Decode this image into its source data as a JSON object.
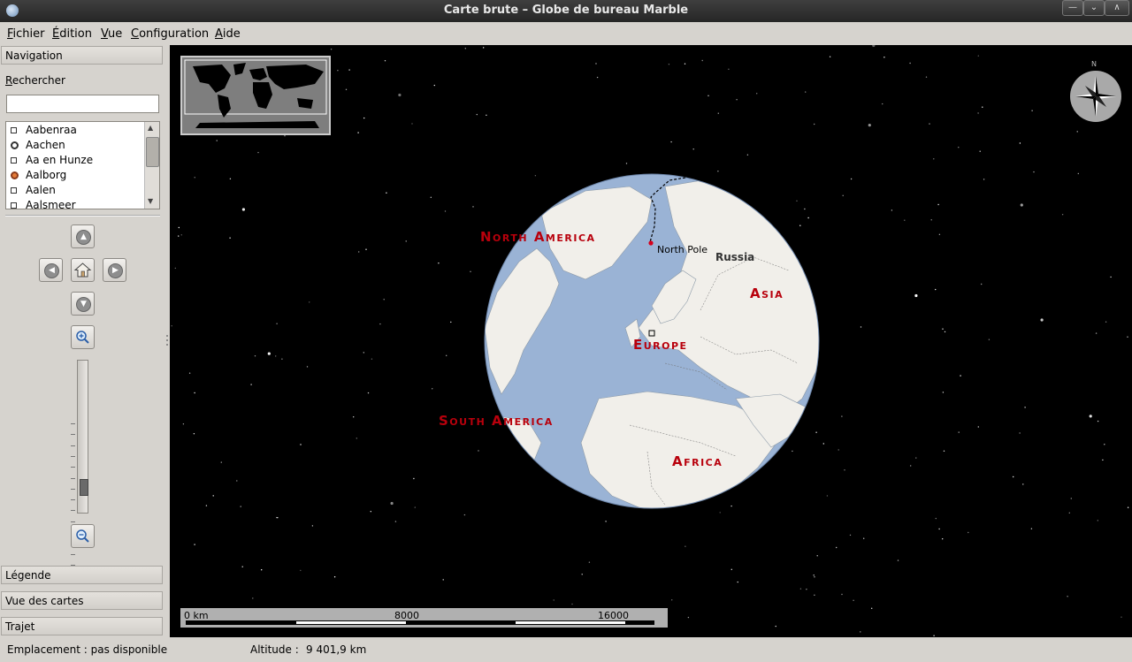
{
  "window": {
    "title": "Carte brute – Globe de bureau Marble"
  },
  "menubar": {
    "items": [
      {
        "accel": "F",
        "rest": "ichier"
      },
      {
        "accel": "É",
        "rest": "dition"
      },
      {
        "accel": "V",
        "rest": "ue"
      },
      {
        "accel": "C",
        "rest": "onfiguration"
      },
      {
        "accel": "A",
        "rest": "ide"
      }
    ]
  },
  "sidebar": {
    "navigation_header": "Navigation",
    "search_label_accel": "R",
    "search_label_rest": "echercher",
    "search_value": "",
    "places": [
      {
        "name": "Aabenraa",
        "icon": "square-bullet-icon"
      },
      {
        "name": "Aachen",
        "icon": "round-bullet-icon"
      },
      {
        "name": "Aa en Hunze",
        "icon": "square-bullet-icon"
      },
      {
        "name": "Aalborg",
        "icon": "orange-round-bullet-icon"
      },
      {
        "name": "Aalen",
        "icon": "square-bullet-icon"
      },
      {
        "name": "Aalsmeer",
        "icon": "square-bullet-icon"
      }
    ],
    "zoom_level_fraction": 0.12,
    "legend_header": "Légende",
    "map_view_header": "Vue des cartes",
    "route_header": "Trajet"
  },
  "map": {
    "continents": {
      "north_america": "North America",
      "south_america": "South America",
      "europe": "Europe",
      "asia": "Asia",
      "africa": "Africa"
    },
    "labels": {
      "north_pole": "North Pole",
      "russia": "Russia"
    },
    "compass_n": "N",
    "scale": {
      "l0": "0 km",
      "l1": "8000",
      "l2": "16000"
    },
    "colors": {
      "ocean": "#9ab3d5",
      "land": "#f1efea",
      "continent_label": "#b8000c",
      "space": "#000000"
    }
  },
  "status": {
    "location_label": "Emplacement : pas disponible",
    "altitude_label": "Altitude :",
    "altitude_value": "9 401,9 km"
  }
}
